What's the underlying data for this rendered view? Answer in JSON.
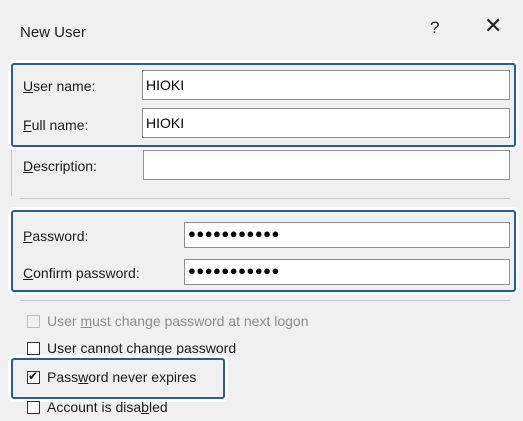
{
  "window": {
    "title": "New User",
    "help_glyph": "?",
    "close_glyph": "✕"
  },
  "user": {
    "user_name_label": "User name:",
    "user_name_value": "HIOKI",
    "full_name_label": "Full name:",
    "full_name_value": "HIOKI",
    "description_label": "Description:",
    "description_value": ""
  },
  "password": {
    "password_label": "Password:",
    "password_mask": "●●●●●●●●●●●",
    "confirm_label": "Confirm password:",
    "confirm_mask": "●●●●●●●●●●●"
  },
  "options": {
    "must_change": {
      "label": "User must change password at next logon",
      "checked": false,
      "enabled": false
    },
    "cannot_change": {
      "label": "User cannot change password",
      "checked": false,
      "enabled": true
    },
    "never_expires": {
      "label": "Password never expires",
      "checked": true,
      "enabled": true
    },
    "disabled": {
      "label": "Account is disabled",
      "checked": false,
      "enabled": true
    }
  },
  "check_glyph": "✔"
}
